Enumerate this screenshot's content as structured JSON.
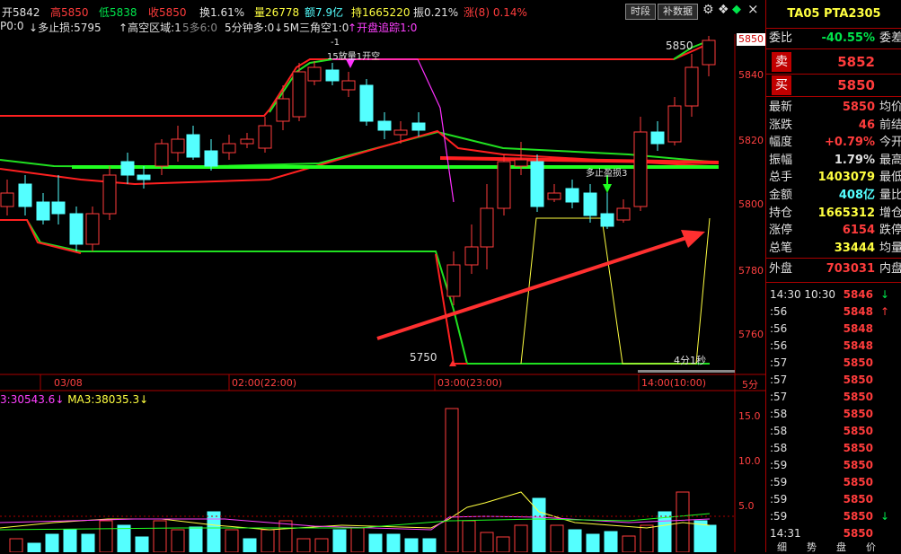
{
  "top": {
    "open_label": "开",
    "open": "5842",
    "high_label": "高",
    "high": "5850",
    "low_label": "低",
    "low": "5838",
    "close_label": "收",
    "close": "5850",
    "turn_label": "换",
    "turn": "1.61%",
    "vol_label": "量",
    "vol": "26778",
    "amt_label": "额",
    "amt": "7.9亿",
    "oi_label": "持",
    "oi": "1665220",
    "amp_label": "振",
    "amp": "0.21%",
    "chg_label": "涨(8)",
    "chg": "0.14%",
    "btn_time": "时段",
    "btn_fill": "补数据"
  },
  "indicator": {
    "prefix": "P0:0",
    "stop": "多止损:5795",
    "zone": "高空区域:1",
    "ratio": "5多6:0",
    "min5": "5分钟多:0",
    "tri": "5M三角空1:0",
    "open": "开盘追踪1:0"
  },
  "annotations": {
    "top_minus": "-1",
    "signal1": "15放量1开空",
    "signal2": "多止盈损3",
    "high_mark": "5850",
    "low_mark": "5750",
    "timer": "4分1秒"
  },
  "price_axis": [
    "5850",
    "5840",
    "5820",
    "5800",
    "5780",
    "5760"
  ],
  "time_axis": [
    "03/08",
    "02:00(22:00)",
    "03:00(23:00)",
    "14:00(10:00)",
    "5分"
  ],
  "volume_bar": {
    "ma2": "30543.6",
    "ma3_label": "MA3:",
    "ma3": "38035.3"
  },
  "vol_axis": [
    "15.0",
    "10.0",
    "5.0"
  ],
  "panel": {
    "code": "TA05",
    "name": "PTA2305",
    "ratio_label": "委比",
    "ratio": "-40.55%",
    "ratio_right": "委差",
    "sell_label": "卖",
    "sell": "5852",
    "buy_label": "买",
    "buy": "5850",
    "rows": [
      {
        "l": "最新",
        "v": "5850",
        "c": "red",
        "r": "均价"
      },
      {
        "l": "涨跌",
        "v": "46",
        "c": "red",
        "r": "前结"
      },
      {
        "l": "幅度",
        "v": "+0.79%",
        "c": "red",
        "r": "今开"
      },
      {
        "l": "振幅",
        "v": "1.79%",
        "c": "white",
        "r": "最高"
      },
      {
        "l": "总手",
        "v": "1403079",
        "c": "yellow",
        "r": "最低"
      },
      {
        "l": "金额",
        "v": "408亿",
        "c": "cyan",
        "r": "量比"
      },
      {
        "l": "持仓",
        "v": "1665312",
        "c": "yellow",
        "r": "增仓"
      },
      {
        "l": "涨停",
        "v": "6154",
        "c": "red",
        "r": "跌停"
      },
      {
        "l": "总笔",
        "v": "33444",
        "c": "yellow",
        "r": "均量"
      }
    ],
    "outer_label": "外盘",
    "outer": "703031",
    "inner_label": "内盘",
    "ticks": [
      {
        "t": "14:30 10:30",
        "p": "5846",
        "a": "↓",
        "ac": "green"
      },
      {
        "t": ":56",
        "p": "5848",
        "a": "↑",
        "ac": "red"
      },
      {
        "t": ":56",
        "p": "5848",
        "a": "",
        "ac": "red"
      },
      {
        "t": ":56",
        "p": "5848",
        "a": "",
        "ac": "red"
      },
      {
        "t": ":57",
        "p": "5850",
        "a": "",
        "ac": "red"
      },
      {
        "t": ":57",
        "p": "5850",
        "a": "",
        "ac": "red"
      },
      {
        "t": ":57",
        "p": "5850",
        "a": "",
        "ac": "red"
      },
      {
        "t": ":58",
        "p": "5850",
        "a": "",
        "ac": "red"
      },
      {
        "t": ":58",
        "p": "5850",
        "a": "",
        "ac": "red"
      },
      {
        "t": ":58",
        "p": "5850",
        "a": "",
        "ac": "red"
      },
      {
        "t": ":59",
        "p": "5850",
        "a": "",
        "ac": "red"
      },
      {
        "t": ":59",
        "p": "5850",
        "a": "",
        "ac": "red"
      },
      {
        "t": ":59",
        "p": "5850",
        "a": "",
        "ac": "red"
      },
      {
        "t": ":59",
        "p": "5850",
        "a": "↓",
        "ac": "green"
      },
      {
        "t": "14:31",
        "p": "5850",
        "a": "",
        "ac": "red"
      }
    ],
    "bottom_tabs": [
      "细",
      "势",
      "盘",
      "价"
    ]
  },
  "colors": {
    "up": "#ff3c3c",
    "down": "#54ffff",
    "ma_red": "#ff2020",
    "ma_green": "#20e020",
    "grid": "#800000"
  }
}
